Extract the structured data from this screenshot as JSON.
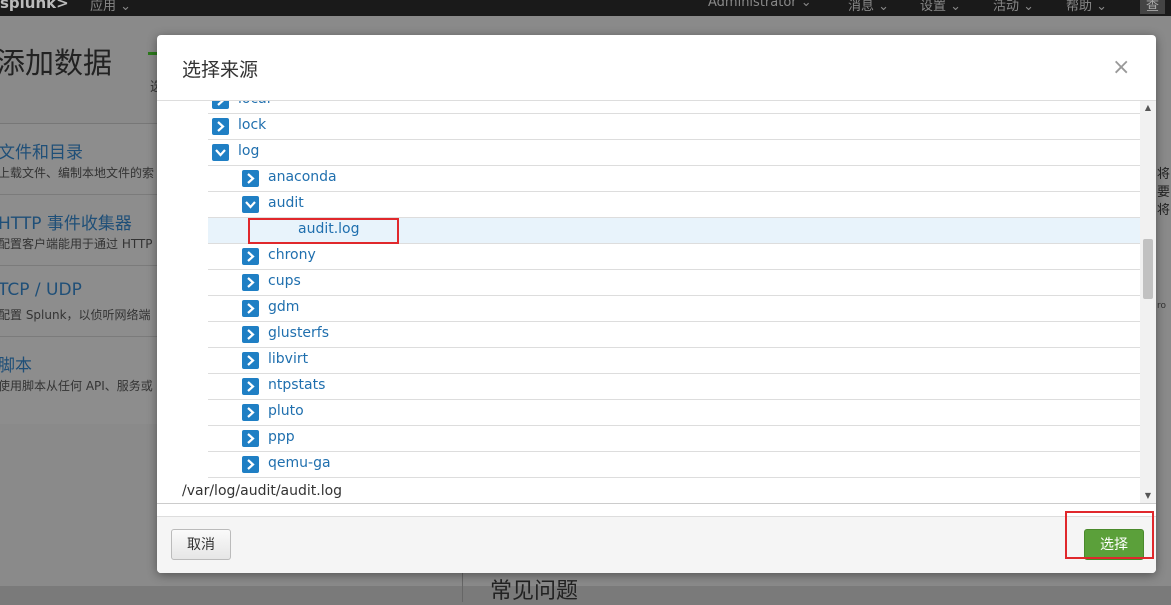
{
  "topbar": {
    "logo": "splunk>",
    "apps": "应用 ⌄",
    "nav": [
      "Administrator ⌄",
      "消息 ⌄",
      "设置 ⌄",
      "活动 ⌄",
      "帮助 ⌄"
    ],
    "search": "查"
  },
  "background": {
    "page_title": "添加数据",
    "step": "选",
    "sources": [
      {
        "title": "文件和目录",
        "desc": "上载文件、编制本地文件的索"
      },
      {
        "title": "HTTP 事件收集器",
        "desc": "配置客户端能用于通过 HTTP"
      },
      {
        "title": "TCP / UDP",
        "desc": "配置 Splunk，以侦听网络端"
      },
      {
        "title": "脚本",
        "desc": "使用脚本从任何 API、服务或"
      }
    ],
    "right_text_1": "将",
    "right_text_2": "要将",
    "right_text_3": "ro",
    "bottom_text": "常见问题"
  },
  "modal": {
    "title": "选择来源",
    "close_glyph": "×",
    "tree": [
      {
        "label": "local",
        "depth": 0,
        "type": "folder",
        "expanded": false
      },
      {
        "label": "lock",
        "depth": 0,
        "type": "folder",
        "expanded": false
      },
      {
        "label": "log",
        "depth": 0,
        "type": "folder",
        "expanded": true
      },
      {
        "label": "anaconda",
        "depth": 1,
        "type": "folder",
        "expanded": false
      },
      {
        "label": "audit",
        "depth": 1,
        "type": "folder",
        "expanded": true
      },
      {
        "label": "audit.log",
        "depth": 2,
        "type": "file",
        "selected": true
      },
      {
        "label": "chrony",
        "depth": 1,
        "type": "folder",
        "expanded": false
      },
      {
        "label": "cups",
        "depth": 1,
        "type": "folder",
        "expanded": false
      },
      {
        "label": "gdm",
        "depth": 1,
        "type": "folder",
        "expanded": false
      },
      {
        "label": "glusterfs",
        "depth": 1,
        "type": "folder",
        "expanded": false
      },
      {
        "label": "libvirt",
        "depth": 1,
        "type": "folder",
        "expanded": false
      },
      {
        "label": "ntpstats",
        "depth": 1,
        "type": "folder",
        "expanded": false
      },
      {
        "label": "pluto",
        "depth": 1,
        "type": "folder",
        "expanded": false
      },
      {
        "label": "ppp",
        "depth": 1,
        "type": "folder",
        "expanded": false
      },
      {
        "label": "qemu-ga",
        "depth": 1,
        "type": "folder",
        "expanded": false
      }
    ],
    "selected_path": "/var/log/audit/audit.log",
    "cancel_label": "取消",
    "select_label": "选择"
  },
  "colors": {
    "accent": "#1f7fc4",
    "primary_button": "#5ba03a",
    "highlight_box": "#e0282c"
  }
}
